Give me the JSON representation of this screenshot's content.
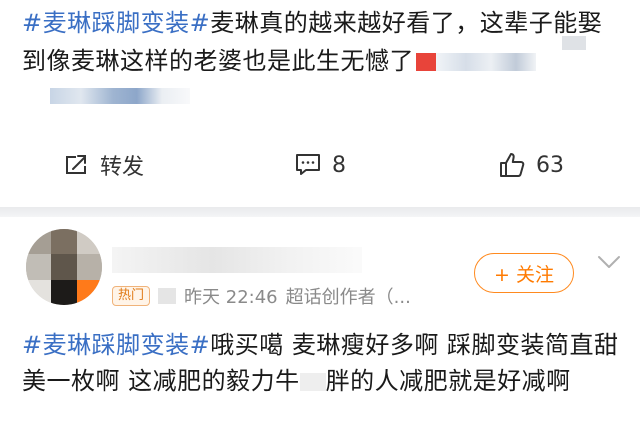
{
  "post": {
    "hashtag": "#麦琳踩脚变装#",
    "text": "麦琳真的越来越好看了，这辈子能娶到像麦琳这样的老婆也是此生无憾了"
  },
  "actions": {
    "repost_label": "转发",
    "comment_count": "8",
    "like_count": "63"
  },
  "comment": {
    "badge": "热门",
    "time": "昨天 22:46",
    "source": "超话创作者（...",
    "follow_label": "+ 关注",
    "hashtag": "#麦琳踩脚变装#",
    "text_part1": "哦买噶 麦琳瘦好多啊 踩脚变装简直甜美一枚啊 这减肥的毅力牛",
    "text_part2": "胖的人减肥就是好减啊"
  },
  "colors": {
    "hashtag": "#3a6fc4",
    "follow": "#ff7a00",
    "divider": "#eeeff1"
  },
  "icons": [
    "repost-icon",
    "comment-icon",
    "like-icon",
    "chevron-down-icon"
  ]
}
